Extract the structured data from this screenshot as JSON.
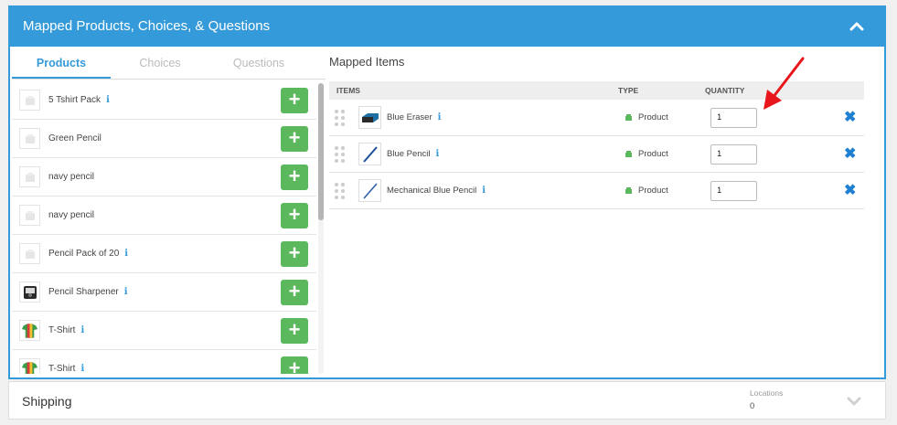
{
  "panel": {
    "title": "Mapped Products, Choices, & Questions",
    "collapse_icon": "chevron-up-icon"
  },
  "tabs": [
    {
      "label": "Products",
      "active": true
    },
    {
      "label": "Choices",
      "active": false
    },
    {
      "label": "Questions",
      "active": false
    }
  ],
  "products": [
    {
      "label": "5 Tshirt Pack",
      "info": true,
      "thumb": "placeholder"
    },
    {
      "label": "Green Pencil",
      "info": false,
      "thumb": "placeholder"
    },
    {
      "label": "navy pencil",
      "info": false,
      "thumb": "placeholder"
    },
    {
      "label": "navy pencil",
      "info": false,
      "thumb": "placeholder"
    },
    {
      "label": "Pencil Pack of 20",
      "info": true,
      "thumb": "placeholder"
    },
    {
      "label": "Pencil Sharpener",
      "info": true,
      "thumb": "sharpener"
    },
    {
      "label": "T-Shirt",
      "info": true,
      "thumb": "tshirt"
    },
    {
      "label": "T-Shirt",
      "info": true,
      "thumb": "tshirt"
    }
  ],
  "add_label": "+",
  "info_glyph": "i",
  "mapped": {
    "title": "Mapped Items",
    "headers": {
      "items": "ITEMS",
      "type": "TYPE",
      "quantity": "QUANTITY"
    },
    "rows": [
      {
        "name": "Blue Eraser",
        "type": "Product",
        "quantity": "1",
        "thumb": "eraser"
      },
      {
        "name": "Blue Pencil",
        "type": "Product",
        "quantity": "1",
        "thumb": "pencil"
      },
      {
        "name": "Mechanical Blue Pencil",
        "type": "Product",
        "quantity": "1",
        "thumb": "pencil"
      }
    ],
    "remove_glyph": "✖"
  },
  "shipping": {
    "title": "Shipping",
    "locations_label": "Locations",
    "locations_value": "0",
    "expand_icon": "chevron-down-icon"
  },
  "colors": {
    "primary": "#359ad9",
    "add_button": "#5cb85c",
    "remove": "#1f7fd1",
    "type_icon": "#5cb85c",
    "annotation_arrow": "#e8161b"
  }
}
